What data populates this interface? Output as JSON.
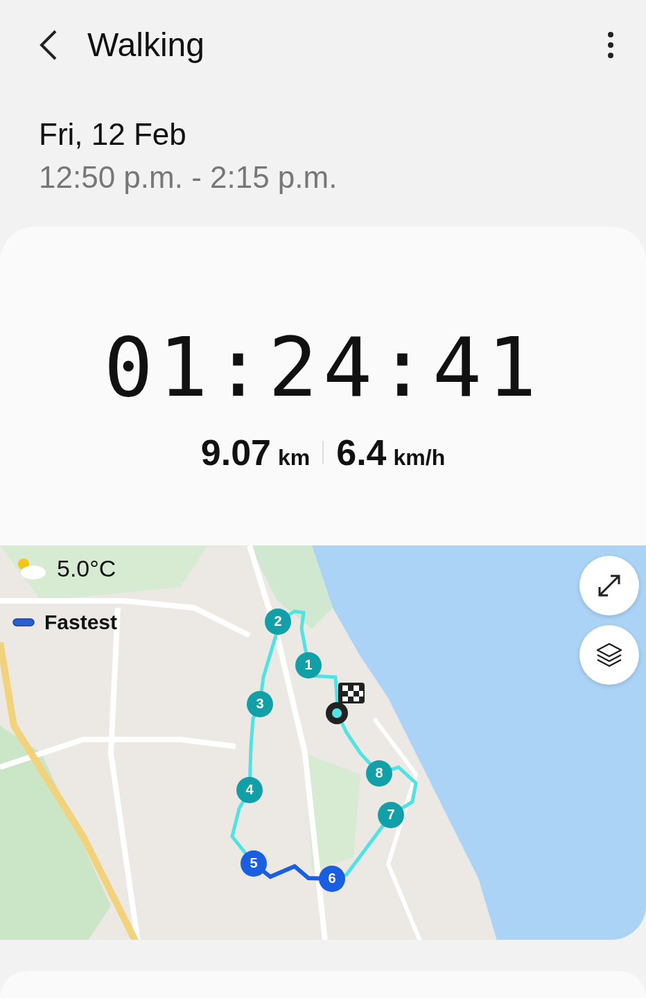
{
  "header": {
    "title": "Walking"
  },
  "session": {
    "date": "Fri, 12 Feb",
    "time_range": "12:50 p.m. - 2:15 p.m."
  },
  "summary": {
    "duration": "01:24:41",
    "distance": "9.07",
    "distance_unit": "km",
    "speed": "6.4",
    "speed_unit": "km/h"
  },
  "map": {
    "weather": "5.0°C",
    "legend": "Fastest",
    "markers": [
      {
        "label": "1",
        "fastest": false
      },
      {
        "label": "2",
        "fastest": false
      },
      {
        "label": "3",
        "fastest": false
      },
      {
        "label": "4",
        "fastest": false
      },
      {
        "label": "5",
        "fastest": true
      },
      {
        "label": "6",
        "fastest": true
      },
      {
        "label": "7",
        "fastest": false
      },
      {
        "label": "8",
        "fastest": false
      }
    ]
  }
}
